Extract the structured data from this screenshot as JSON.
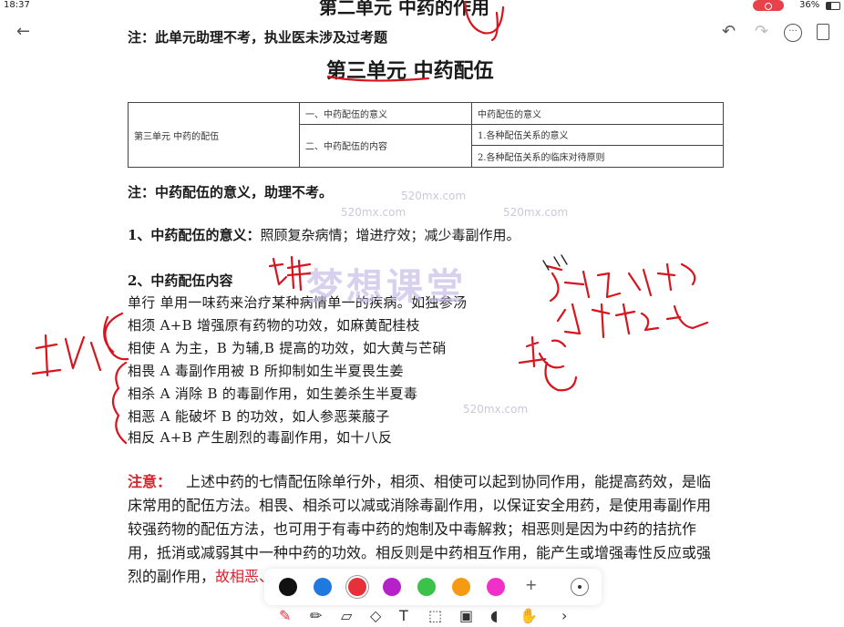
{
  "status": {
    "time": "18:37",
    "battery": "36%"
  },
  "toolbar": {
    "back_icon": "arrow-left-icon",
    "undo_icon": "undo-icon",
    "redo_icon": "redo-icon",
    "more_icon": "more-icon",
    "pages_icon": "pages-icon"
  },
  "document": {
    "prev_heading": "第二单元  中药的作用",
    "note1": "注：此单元助理不考，执业医未涉及过考题",
    "unit_title": "第三单元  中药配伍",
    "outline": {
      "unit": "第三单元    中药的配伍",
      "rows": [
        {
          "sub": "一、中药配伍的意义",
          "point": "中药配伍的意义"
        },
        {
          "sub": "二、中药配伍的内容",
          "point": "1.各种配伍关系的意义"
        },
        {
          "sub": "",
          "point": "2.各种配伍关系的临床对待原则"
        }
      ]
    },
    "note2": "注：中药配伍的意义，助理不考。",
    "item1_label": "1、中药配伍的意义：",
    "item1_text": "照顾复杂病情；增进疗效；减少毒副作用。",
    "item2_label": "2、中药配伍内容",
    "relations": [
      "单行  单用一味药来治疗某种病情单一的疾病。如独参汤",
      "相须  A+B 增强原有药物的功效，如麻黄配桂枝",
      "相使  A 为主，B 为辅,B 提高的功效，如大黄与芒硝",
      "相畏  A 毒副作用被 B 所抑制如生半夏畏生姜",
      "相杀  A 消除 B 的毒副作用，如生姜杀生半夏毒",
      "相恶  A 能破坏 B 的功效，如人参恶莱菔子",
      "相反  A+B 产生剧烈的毒副作用，如十八反"
    ],
    "para_label": "注意：",
    "para_text": "上述中药的七情配伍除单行外，相须、相使可以起到协同作用，能提高药效，是临床常用的配伍方法。相畏、相杀可以减或消除毒副作用，以保证安全用药，是使用毒副作用较强药物的配伍方法，也可用于有毒中药的炮制及中毒解救；相恶则是因为中药的拮抗作用，抵消或减弱其中一种中药的功效。相反则是中药相互作用，能产生或增强毒性反应或强烈的副作用，",
    "para_red": "故相恶、相反是中医配伍用药的禁忌"
  },
  "watermark": {
    "big": "梦想课堂",
    "small": "520mx.com"
  },
  "handwriting": {
    "left": "协",
    "top": "七情",
    "right1": "单药不用配",
    "right2": "单味不宜配",
    "right3": "毒"
  },
  "palette": {
    "colors": [
      "#111111",
      "#1f7ae0",
      "#e8303a",
      "#b620c8",
      "#3cc14a",
      "#f59a12",
      "#f030c8"
    ],
    "selected": "#e8303a",
    "add_label": "+"
  },
  "tools": [
    "pen-icon",
    "pencil-icon",
    "marker-icon",
    "eraser-icon",
    "text-icon",
    "lasso-icon",
    "image-icon",
    "mic-icon",
    "hand-icon",
    "chevron-right-icon"
  ]
}
